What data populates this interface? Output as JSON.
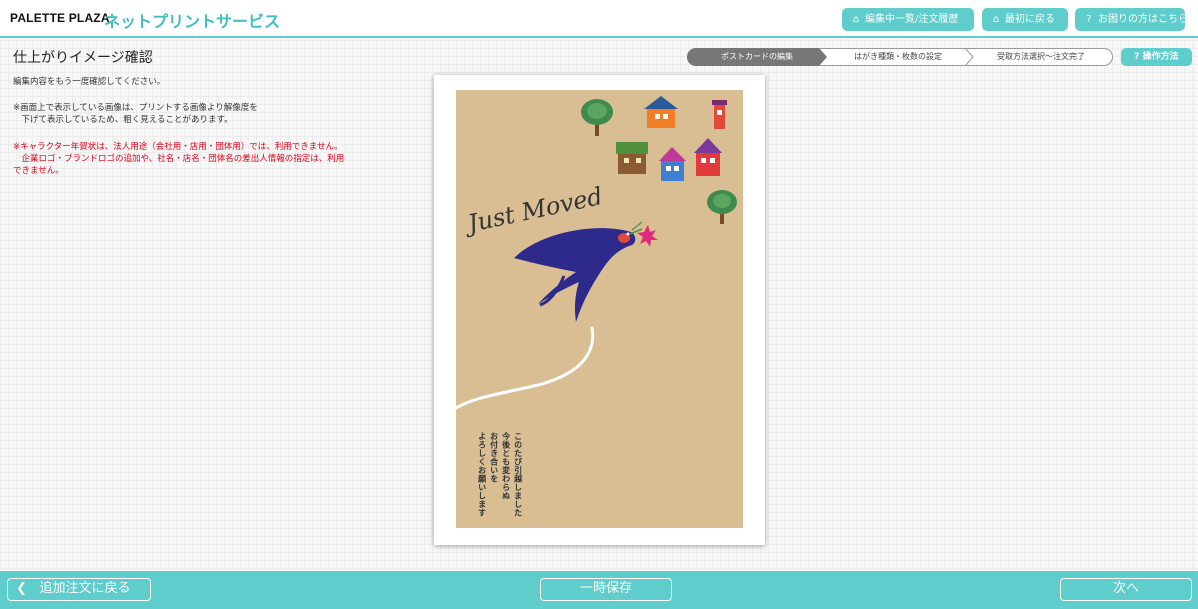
{
  "header": {
    "brand": "PALETTE PLAZA",
    "service": "ネットプリントサービス",
    "buttons": [
      {
        "label": "編集中一覧/注文履歴",
        "icon": "home-icon"
      },
      {
        "label": "最初に戻る",
        "icon": "home-icon"
      },
      {
        "label": "お困りの方はこちら",
        "icon": "question-icon"
      }
    ]
  },
  "page": {
    "title": "仕上がりイメージ確認",
    "note1": "編集内容をもう一度確認してください。",
    "note2": "※画面上で表示している画像は、プリントする画像より解像度を\n　下げて表示しているため、粗く見えることがあります。",
    "note3": "※キャラクター年賀状は、法人用途（会社用・店用・団体用）では、利用できません。\n　企業ロゴ・ブランドロゴの追加や、社名・店名・団体名の差出人情報の指定は、利用\nできません。"
  },
  "steps": [
    {
      "label": "ポストカードの編集",
      "active": true
    },
    {
      "label": "はがき種類・枚数の設定",
      "active": false
    },
    {
      "label": "受取方法選択～注文完了",
      "active": false
    }
  ],
  "help_button": {
    "label": "操作方法",
    "icon": "question-icon"
  },
  "card": {
    "headline": "Just Moved",
    "message_lines": [
      "このたび引越しました",
      "今後とも変わらぬ",
      "お付き合いを",
      "よろしくお願いします"
    ],
    "colors": {
      "background": "#d9be93",
      "bird": "#2e2a8c",
      "flower": "#e2287a"
    }
  },
  "footer": {
    "back_label": "追加注文に戻る",
    "save_label": "一時保存",
    "next_label": "次へ"
  },
  "colors": {
    "accent": "#5ecdcb",
    "warning": "#e2001a",
    "step_active": "#777777"
  }
}
